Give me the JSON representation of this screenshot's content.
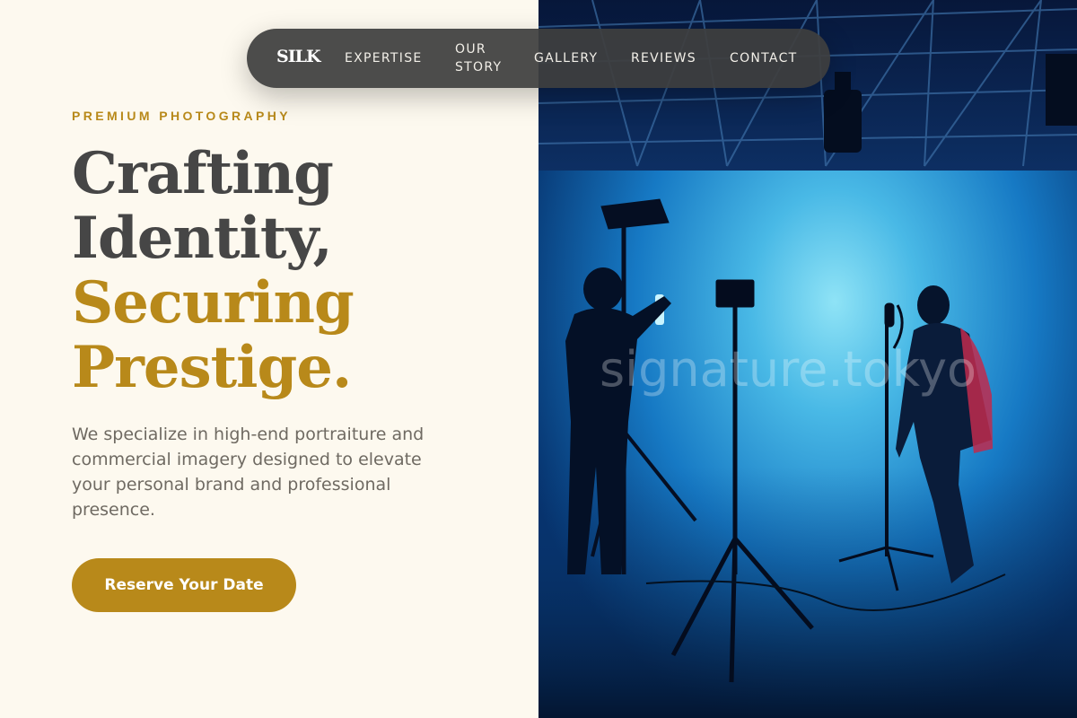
{
  "nav": {
    "logo": "SILK",
    "items": [
      {
        "label": "EXPERTISE"
      },
      {
        "label": "OUR STORY"
      },
      {
        "label": "GALLERY"
      },
      {
        "label": "REVIEWS"
      },
      {
        "label": "CONTACT"
      }
    ]
  },
  "hero": {
    "eyebrow": "PREMIUM PHOTOGRAPHY",
    "headline_lines": [
      "Crafting",
      "Identity,",
      "Securing",
      "Prestige."
    ],
    "lede": "We specialize in high-end portraiture and commercial imagery designed to elevate your personal brand and professional presence.",
    "cta_label": "Reserve Your Date"
  },
  "photo": {
    "watermark": "signature.tokyo",
    "description_icon": "studio-photo"
  },
  "colors": {
    "accent": "#b8891a",
    "background": "#fdf9ef",
    "headline_dark": "#464646",
    "nav_bg": "#3e3e3e"
  }
}
